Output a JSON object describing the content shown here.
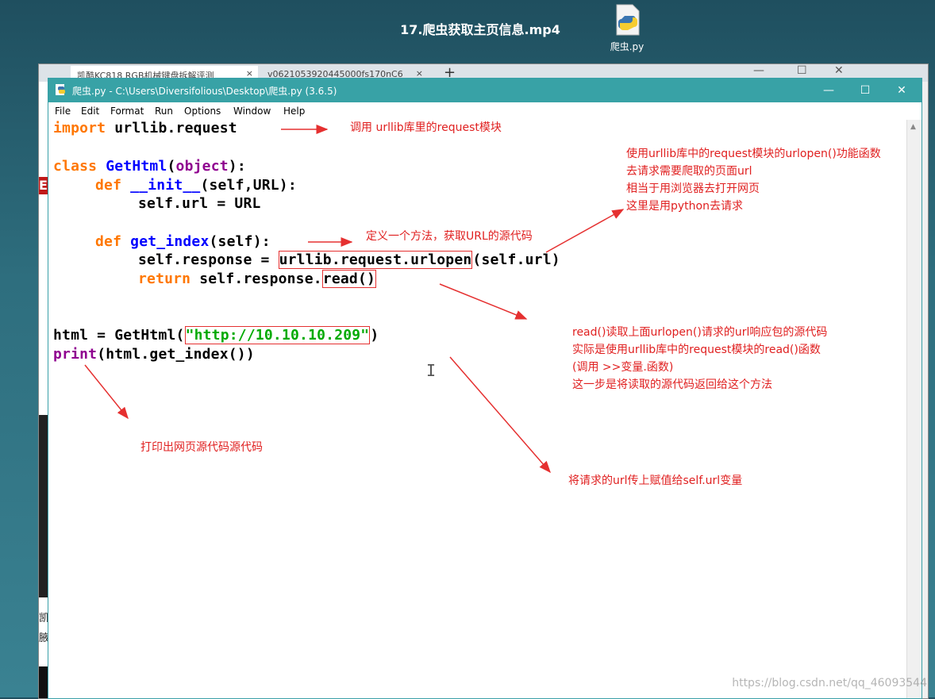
{
  "video_title": "17.爬虫获取主页信息.mp4",
  "desktop_icon": {
    "label": "爬虫.py"
  },
  "browser": {
    "tabs": [
      "凯酷KC818 RGB机械键盘拆解评测",
      "v0621053920445000fs170nC6"
    ],
    "tab_close": "×",
    "new_tab": "+",
    "controls": [
      "—",
      "☐",
      "✕"
    ],
    "side_letter": "E",
    "side_texts": [
      "凯",
      "腋"
    ]
  },
  "idle": {
    "title": "爬虫.py - C:\\Users\\Diversifolious\\Desktop\\爬虫.py (3.6.5)",
    "controls": {
      "minimize": "—",
      "maximize": "☐",
      "close": "✕"
    },
    "menus": [
      "File",
      "Edit",
      "Format",
      "Run",
      "Options",
      "Window",
      "Help"
    ]
  },
  "code": {
    "l1_kw": "import",
    "l1_rest": " urllib.request",
    "l2_kw": "class",
    "l2_name": "GetHtml",
    "l2_p1": "(",
    "l2_bi": "object",
    "l2_p2": "):",
    "l3_kw": "def",
    "l3_name": "__init__",
    "l3_rest": "(self,URL):",
    "l4": "self.url = URL",
    "l5_kw": "def",
    "l5_name": "get_index",
    "l5_rest": "(self):",
    "l6_pre": "self.response = ",
    "l6_hl": "urllib.request.urlopen",
    "l6_post": "(self.url)",
    "l7_kw": "return",
    "l7_pre": " self.response.",
    "l7_hl": "read()",
    "l8_pre": "html = GetHtml(",
    "l8_str": "\"http://10.10.10.209\"",
    "l8_post": ")",
    "l9_bi": "print",
    "l9_rest": "(html.get_index())"
  },
  "annotations": {
    "a1": "调用 urllib库里的request模块",
    "a2": [
      "使用urllib库中的request模块的urlopen()功能函数",
      "去请求需要爬取的页面url",
      "相当于用浏览器去打开网页",
      "这里是用python去请求"
    ],
    "a3": "定义一个方法，获取URL的源代码",
    "a4": [
      "read()读取上面urlopen()请求的url响应包的源代码",
      "实际是使用urllib库中的request模块的read()函数",
      "(调用 >>变量.函数)",
      "这一步是将读取的源代码返回给这个方法"
    ],
    "a5": "打印出网页源代码源代码",
    "a6": "将请求的url传上赋值给self.url变量"
  },
  "cursor": "I",
  "watermark": "https://blog.csdn.net/qq_46093544",
  "colors": {
    "keyword": "#ff7700",
    "builtin": "#900090",
    "definition": "#0000ff",
    "string": "#00aa00",
    "annotation": "#e02020",
    "titlebar": "#38a2a6"
  }
}
